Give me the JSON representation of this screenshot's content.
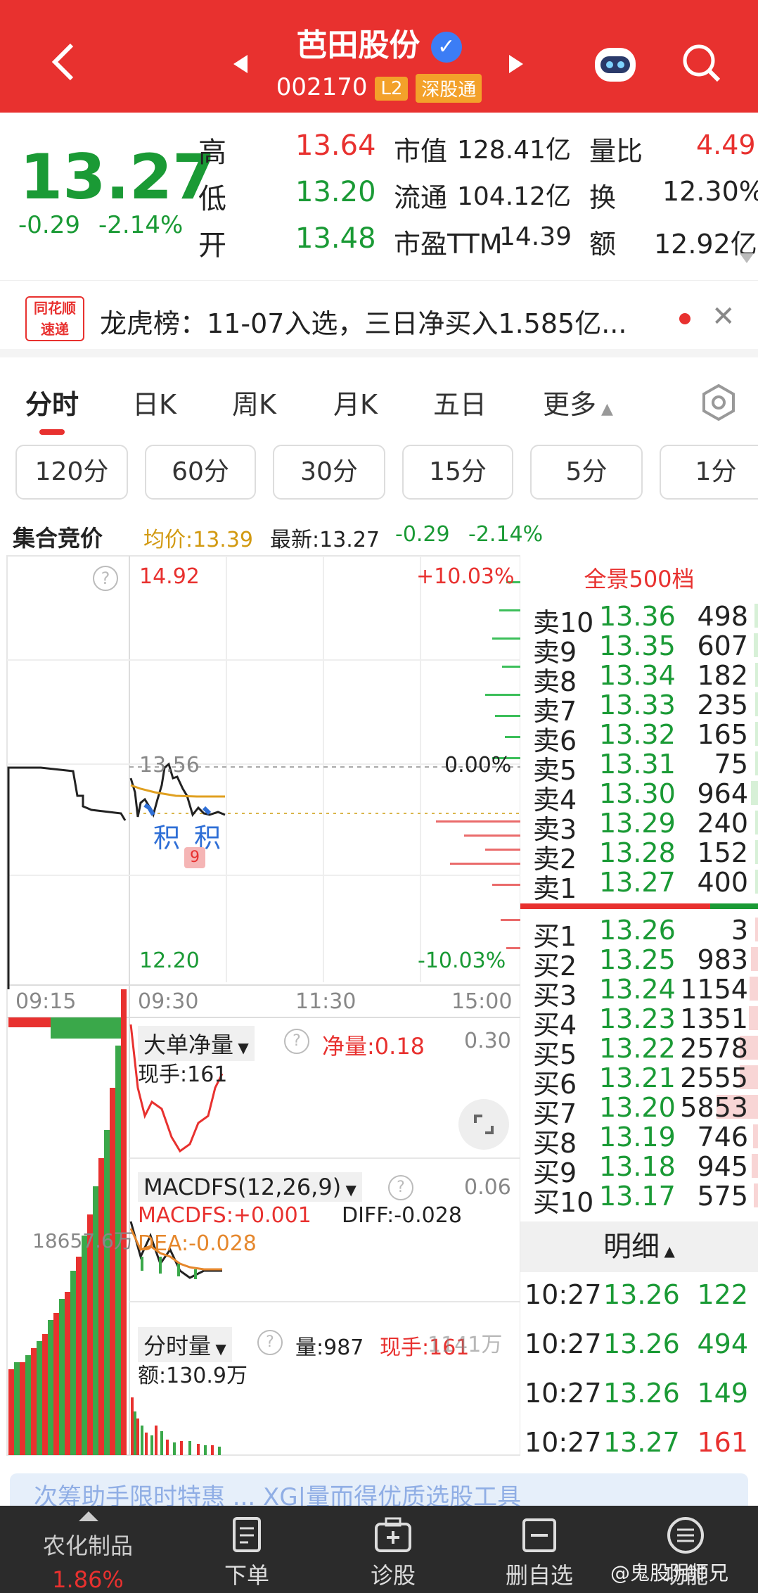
{
  "header": {
    "title": "芭田股份",
    "code": "002170",
    "level": "L2",
    "market": "深股通"
  },
  "quote": {
    "price": "13.27",
    "change": "-0.29",
    "pct": "-2.14%",
    "items": [
      {
        "label": "高",
        "value": "13.64"
      },
      {
        "label": "低",
        "value": "13.20"
      },
      {
        "label": "开",
        "value": "13.48"
      },
      {
        "label": "市值",
        "value": "128.41亿"
      },
      {
        "label": "流通",
        "value": "104.12亿"
      },
      {
        "label": "市盈TTM",
        "value": "14.39"
      },
      {
        "label": "量比",
        "value": "4.49"
      },
      {
        "label": "换",
        "value": "12.30%"
      },
      {
        "label": "额",
        "value": "12.92亿"
      }
    ]
  },
  "news": {
    "brand_line1": "同花顺",
    "brand_line2": "速递",
    "text": "龙虎榜：11-07入选，三日净买入1.585亿..."
  },
  "tabs": [
    "分时",
    "日K",
    "周K",
    "月K",
    "五日",
    "更多"
  ],
  "periods": [
    "120分",
    "60分",
    "30分",
    "15分",
    "5分",
    "1分"
  ],
  "infobar": {
    "label": "集合竞价",
    "avg": "均价:13.39",
    "latest": "最新:13.27",
    "chg": "-0.29",
    "pct": "-2.14%"
  },
  "chart": {
    "top_price": "14.92",
    "top_pct": "+10.03%",
    "mid_price": "13.56",
    "mid_pct": "0.00%",
    "bottom_price": "12.20",
    "bottom_pct": "-10.03%",
    "marker1": "积",
    "marker2": "积",
    "badge": "9",
    "times": [
      "09:15",
      "09:30",
      "11:30",
      "15:00"
    ],
    "vol_label": "18657.6万",
    "p1": {
      "title": "大单净量",
      "sub": "现手:161",
      "right_label": "净量:0.18",
      "right_value": "0.30"
    },
    "p2": {
      "title": "MACDFS(12,26,9)",
      "macd": "MACDFS:+0.001",
      "diff": "DIFF:-0.028",
      "dea": "DEA:-0.028",
      "right_value": "0.06"
    },
    "p3": {
      "title": "分时量",
      "vol": "量:987",
      "cur": "现手:161",
      "amt": "额:130.9万",
      "right_value": "1141万"
    }
  },
  "orderbook": {
    "title": "全景500档",
    "asks": [
      [
        "卖10",
        "13.36",
        "498"
      ],
      [
        "卖9",
        "13.35",
        "607"
      ],
      [
        "卖8",
        "13.34",
        "182"
      ],
      [
        "卖7",
        "13.33",
        "235"
      ],
      [
        "卖6",
        "13.32",
        "165"
      ],
      [
        "卖5",
        "13.31",
        "75"
      ],
      [
        "卖4",
        "13.30",
        "964"
      ],
      [
        "卖3",
        "13.29",
        "240"
      ],
      [
        "卖2",
        "13.28",
        "152"
      ],
      [
        "卖1",
        "13.27",
        "400"
      ]
    ],
    "bids": [
      [
        "买1",
        "13.26",
        "3"
      ],
      [
        "买2",
        "13.25",
        "983"
      ],
      [
        "买3",
        "13.24",
        "1154"
      ],
      [
        "买4",
        "13.23",
        "1351"
      ],
      [
        "买5",
        "13.22",
        "2578"
      ],
      [
        "买6",
        "13.21",
        "2555"
      ],
      [
        "买7",
        "13.20",
        "5853"
      ],
      [
        "买8",
        "13.19",
        "746"
      ],
      [
        "买9",
        "13.18",
        "945"
      ],
      [
        "买10",
        "13.17",
        "575"
      ]
    ],
    "detail_title": "明细",
    "details": [
      [
        "10:27",
        "13.26",
        "122"
      ],
      [
        "10:27",
        "13.26",
        "494"
      ],
      [
        "10:27",
        "13.26",
        "149"
      ],
      [
        "10:27",
        "13.27",
        "161"
      ]
    ]
  },
  "promo": "次筹助手限时特惠 ... XG|量而得优质选股工具",
  "bottom": {
    "sector": "农化制品",
    "sector_pct": "1.86%",
    "nav": [
      "下单",
      "诊股",
      "删自选",
      "功能"
    ],
    "watermark": "@鬼股阴师兄"
  },
  "colors": {
    "red": "#e8312f",
    "green": "#1a9a35"
  }
}
